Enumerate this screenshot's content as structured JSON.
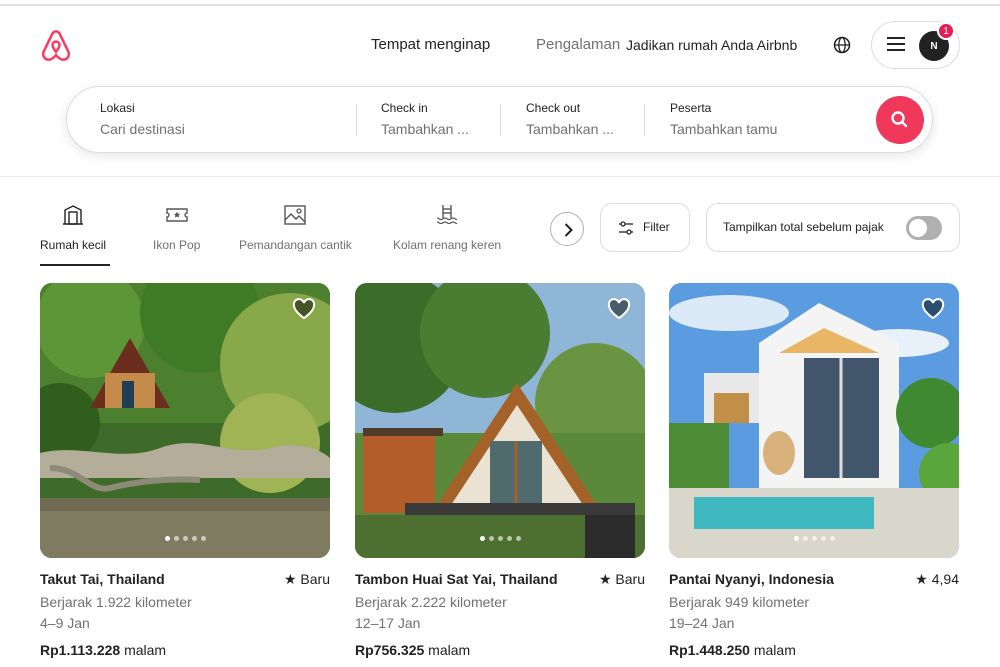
{
  "header": {
    "nav": {
      "stays": "Tempat menginap",
      "experiences": "Pengalaman",
      "host": "Jadikan rumah Anda Airbnb"
    },
    "avatar_initial": "N",
    "notification_count": "1"
  },
  "search": {
    "location": {
      "label": "Lokasi",
      "placeholder": "Cari destinasi"
    },
    "checkin": {
      "label": "Check in",
      "placeholder": "Tambahkan ..."
    },
    "checkout": {
      "label": "Check out",
      "placeholder": "Tambahkan ..."
    },
    "guests": {
      "label": "Peserta",
      "placeholder": "Tambahkan tamu"
    }
  },
  "categories": [
    {
      "label": "Rumah kecil",
      "icon": "tiny-house-icon",
      "active": true
    },
    {
      "label": "Ikon Pop",
      "icon": "ticket-icon"
    },
    {
      "label": "Pemandangan cantik",
      "icon": "landscape-icon"
    },
    {
      "label": "Kolam renang keren",
      "icon": "pool-icon"
    }
  ],
  "filter_label": "Filter",
  "tax_toggle_label": "Tampilkan total sebelum pajak",
  "listings": [
    {
      "title": "Takut Tai, Thailand",
      "rating": "Baru",
      "distance": "Berjarak 1.922 kilometer",
      "dates": "4–9 Jan",
      "price": "Rp1.113.228",
      "unit": "malam"
    },
    {
      "title": "Tambon Huai Sat Yai, Thailand",
      "rating": "Baru",
      "distance": "Berjarak 2.222 kilometer",
      "dates": "12–17 Jan",
      "price": "Rp756.325",
      "unit": "malam"
    },
    {
      "title": "Pantai Nyanyi, Indonesia",
      "rating": "4,94",
      "distance": "Berjarak 949 kilometer",
      "dates": "19–24 Jan",
      "price": "Rp1.448.250",
      "unit": "malam"
    }
  ],
  "colors": {
    "brand": "#FF385C",
    "text": "#222222",
    "muted": "#717171"
  }
}
